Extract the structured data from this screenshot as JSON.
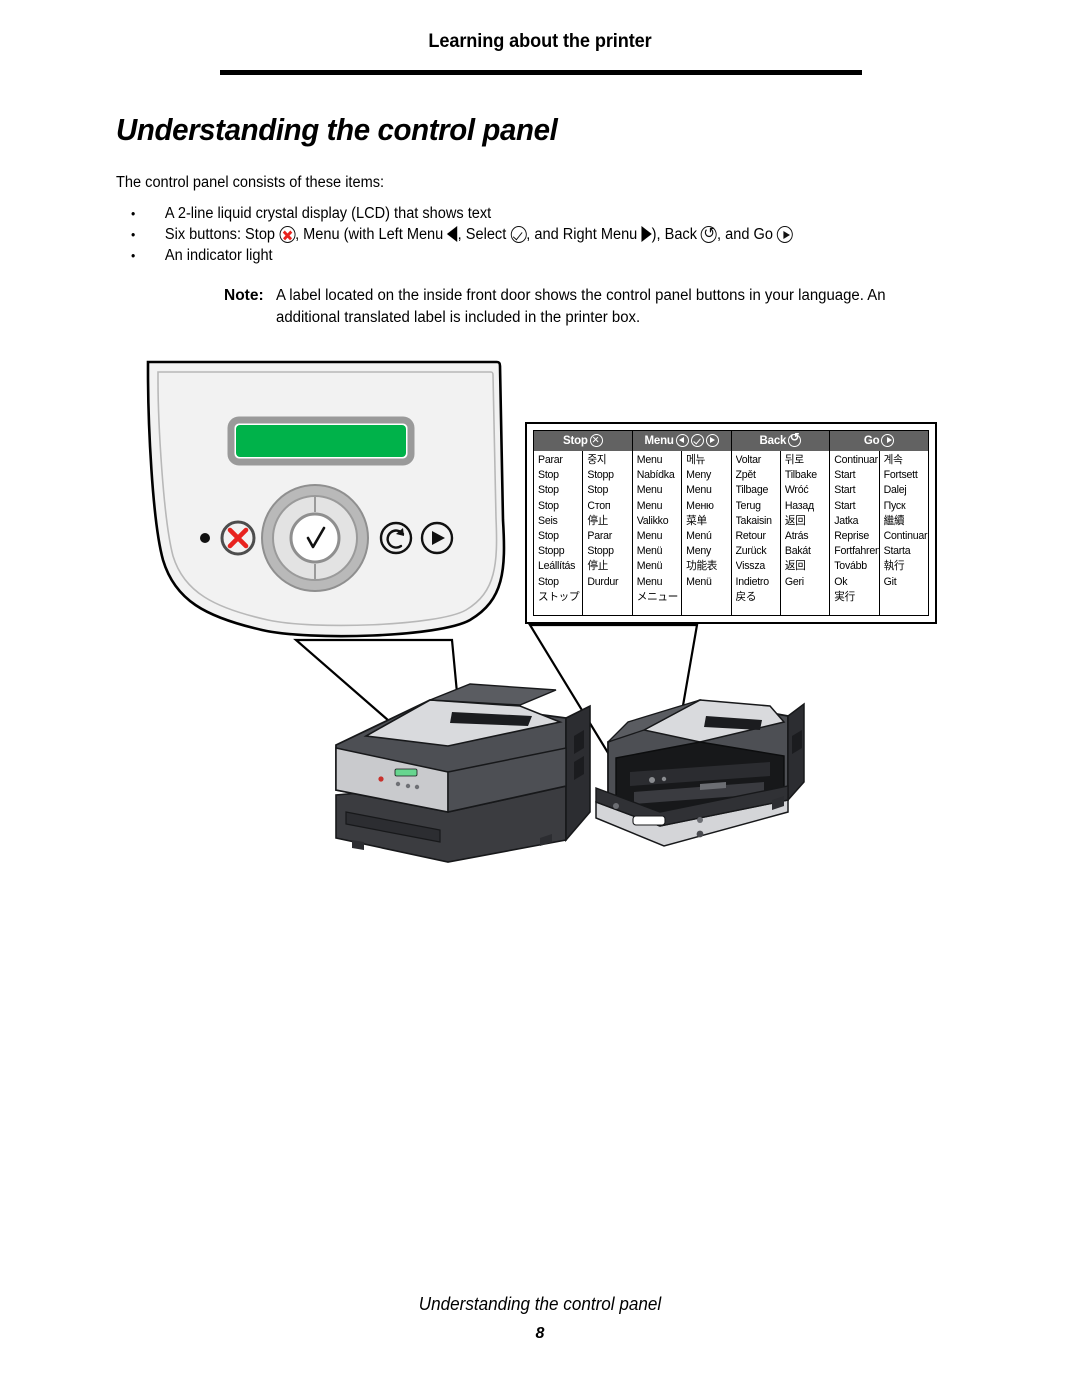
{
  "page": {
    "running_head": "Learning about the printer",
    "section_title": "Understanding the control panel",
    "intro": "The control panel consists of these items:",
    "bullets": [
      {
        "marker": "•",
        "text_before": "A 2-line liquid crystal display (LCD) that shows text"
      },
      {
        "marker": "•"
      },
      {
        "marker": "•",
        "text_before": "An indicator light"
      }
    ],
    "bullet2": {
      "seg1": "Six buttons: Stop",
      "seg2": ", Menu (with Left Menu",
      "seg3": ", Select",
      "seg4": ", and Right Menu",
      "seg5": "), Back",
      "seg6": ", and Go"
    },
    "note": {
      "label": "Note:",
      "body": "A label located on the inside front door shows the control panel buttons in your language. An additional translated label is included in the printer box."
    },
    "footer_title": "Understanding the control panel",
    "footer_page": "8"
  },
  "control_panel": {
    "lcd_color": "#00b24a",
    "indicator_light": "indicator-light",
    "buttons": [
      "stop",
      "left-menu",
      "select",
      "right-menu",
      "back",
      "go"
    ]
  },
  "label_table": {
    "groups": [
      {
        "header": "Stop",
        "icons": [
          "x-circle"
        ],
        "left": [
          "Parar",
          "Stop",
          "Stop",
          "Stop",
          "Seis",
          "Stop",
          "Stopp",
          "Leállítás",
          "Stop",
          "ストップ"
        ],
        "right": [
          "중지",
          "Stopp",
          "Stop",
          "Стоп",
          "停止",
          "Parar",
          "Stopp",
          "停止",
          "Durdur"
        ]
      },
      {
        "header": "Menu",
        "icons": [
          "left-triangle-circle",
          "check-circle",
          "right-triangle-circle"
        ],
        "left": [
          "Menu",
          "Nabídka",
          "Menu",
          "Menu",
          "Valikko",
          "Menu",
          "Menü",
          "Menü",
          "Menu",
          "メニュー"
        ],
        "right": [
          "메뉴",
          "Meny",
          "Menu",
          "Меню",
          "菜单",
          "Menú",
          "Meny",
          "功能表",
          "Menü"
        ]
      },
      {
        "header": "Back",
        "icons": [
          "back-arrow-circle"
        ],
        "left": [
          "Voltar",
          "Zpět",
          "Tilbage",
          "Terug",
          "Takaisin",
          "Retour",
          "Zurück",
          "Vissza",
          "Indietro",
          "戻る"
        ],
        "right": [
          "뒤로",
          "Tilbake",
          "Wróć",
          "Назад",
          "返回",
          "Atrás",
          "Bakát",
          "返回",
          "Geri"
        ]
      },
      {
        "header": "Go",
        "icons": [
          "play-triangle-circle"
        ],
        "left": [
          "Continuar",
          "Start",
          "Start",
          "Start",
          "Jatka",
          "Reprise",
          "Fortfahren",
          "Tovább",
          "Ok",
          "実行"
        ],
        "right": [
          "계속",
          "Fortsett",
          "Dalej",
          "Пуск",
          "繼續",
          "Continuar",
          "Starta",
          "執行",
          "Git"
        ]
      }
    ]
  }
}
